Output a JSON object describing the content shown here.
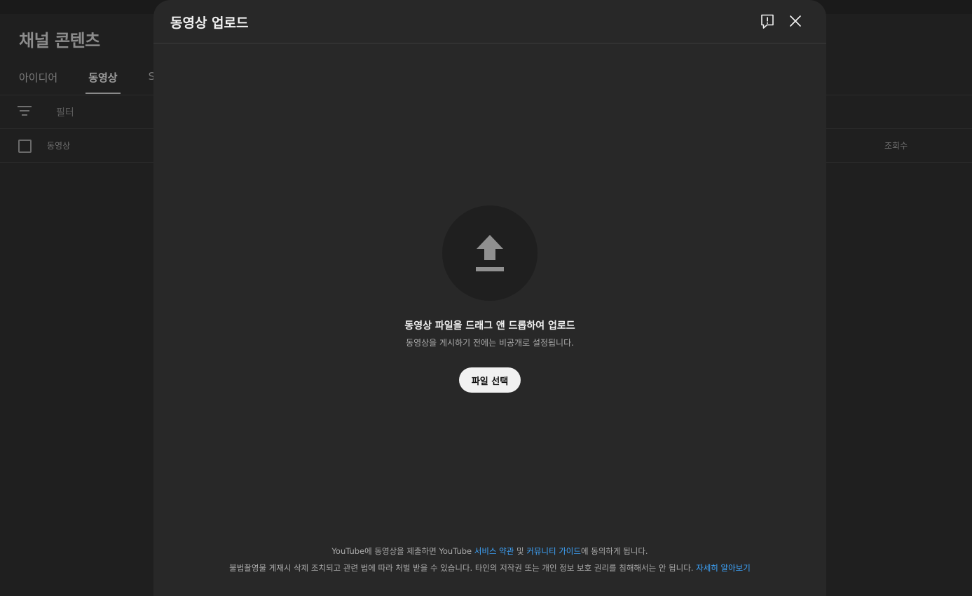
{
  "background": {
    "page_title": "채널 콘텐츠",
    "tabs": [
      {
        "label": "아이디어",
        "active": false
      },
      {
        "label": "동영상",
        "active": true
      },
      {
        "label": "S",
        "active": false
      }
    ],
    "filter_label": "필터",
    "columns": {
      "video": "동영상",
      "views": "조회수"
    }
  },
  "modal": {
    "title": "동영상 업로드",
    "feedback_icon": "feedback-icon",
    "close_icon": "close-icon",
    "upload_icon": "upload-arrow-icon",
    "drop_title": "동영상 파일을 드래그 앤 드롭하여 업로드",
    "drop_subtitle": "동영상을 게시하기 전에는 비공개로 설정됩니다.",
    "select_button": "파일 선택",
    "footer": {
      "line1_part1": "YouTube에 동영상을 제출하면 YouTube ",
      "terms_link": "서비스 약관",
      "line1_part2": " 및 ",
      "guidelines_link": "커뮤니티 가이드",
      "line1_part3": "에 동의하게 됩니다.",
      "line2_text": "불법촬영물 게재시 삭제 조치되고 관련 법에 따라 처벌 받을 수 있습니다. 타인의 저작권 또는 개인 정보 보호 권리를 침해해서는 안 됩니다. ",
      "learn_more_link": "자세히 알아보기"
    }
  },
  "colors": {
    "modal_bg": "#282828",
    "link": "#3ea6ff",
    "button_bg": "#f1f1f1"
  }
}
